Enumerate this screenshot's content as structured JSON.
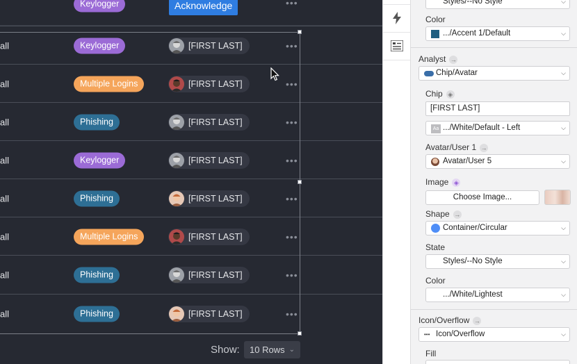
{
  "table": {
    "top_row": {
      "badge": "Keylogger",
      "badge_color": "#9b6bd6",
      "button": "Acknowledge"
    },
    "rows": [
      {
        "prefix": "all",
        "badge": "Keylogger",
        "badge_color": "#9b6bd6",
        "name": "[FIRST LAST]",
        "avatar": "gray-man"
      },
      {
        "prefix": "all",
        "badge": "Multiple Logins",
        "badge_color": "#f5a55b",
        "name": "[FIRST LAST]",
        "avatar": "dark-man"
      },
      {
        "prefix": "all",
        "badge": "Phishing",
        "badge_color": "#2e6f95",
        "name": "[FIRST LAST]",
        "avatar": "gray-man"
      },
      {
        "prefix": "all",
        "badge": "Keylogger",
        "badge_color": "#9b6bd6",
        "name": "[FIRST LAST]",
        "avatar": "gray-man"
      },
      {
        "prefix": "all",
        "badge": "Phishing",
        "badge_color": "#2e6f95",
        "name": "[FIRST LAST]",
        "avatar": "redhead-man"
      },
      {
        "prefix": "all",
        "badge": "Multiple Logins",
        "badge_color": "#f5a55b",
        "name": "[FIRST LAST]",
        "avatar": "dark-man"
      },
      {
        "prefix": "all",
        "badge": "Phishing",
        "badge_color": "#2e6f95",
        "name": "[FIRST LAST]",
        "avatar": "gray-man"
      },
      {
        "prefix": "all",
        "badge": "Phishing",
        "badge_color": "#2e6f95",
        "name": "[FIRST LAST]",
        "avatar": "redhead-man"
      }
    ],
    "more_icon": "•••"
  },
  "pagination": {
    "show_label": "Show:",
    "rows_value": "10 Rows"
  },
  "toolbar": {
    "icons": [
      "lightning-icon",
      "properties-icon"
    ]
  },
  "inspector": {
    "top_value": "Styles/--No Style",
    "color_label": "Color",
    "color_value": ".../Accent 1/Default",
    "color_swatch": "#1f5e80",
    "analyst_label": "Analyst",
    "analyst_value": "Chip/Avatar",
    "chip_label": "Chip",
    "chip_text": "[FIRST LAST]",
    "chip_text_style": ".../White/Default - Left",
    "text_style_glyph": "Aa",
    "avatar_label": "Avatar/User 1",
    "avatar_value": "Avatar/User 5",
    "image_label": "Image",
    "choose_image": "Choose Image...",
    "shape_label": "Shape",
    "shape_value": "Container/Circular",
    "shape_color": "#4f8ef7",
    "state_label": "State",
    "state_value": "Styles/--No Style",
    "color2_label": "Color",
    "color2_value": ".../White/Lightest",
    "overflow_label": "Icon/Overflow",
    "overflow_value": "Icon/Overflow",
    "overflow_glyph": "•••",
    "fill_label": "Fill"
  }
}
